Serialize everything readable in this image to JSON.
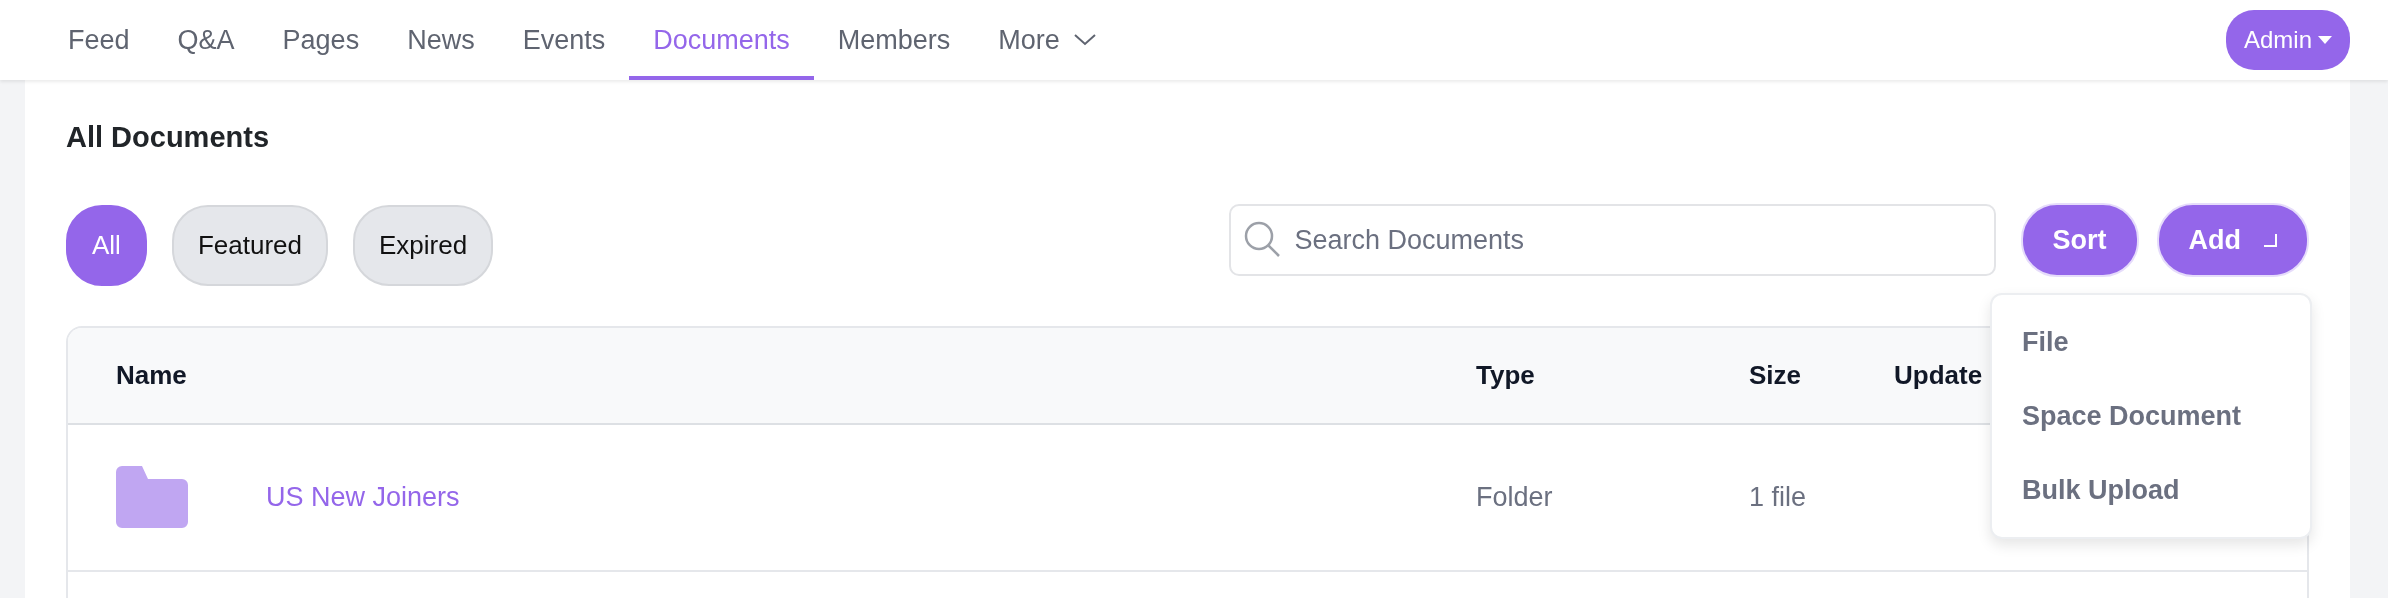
{
  "nav": {
    "tabs": [
      {
        "label": "Feed",
        "selected": false
      },
      {
        "label": "Q&A",
        "selected": false
      },
      {
        "label": "Pages",
        "selected": false
      },
      {
        "label": "News",
        "selected": false
      },
      {
        "label": "Events",
        "selected": false
      },
      {
        "label": "Documents",
        "selected": true
      },
      {
        "label": "Members",
        "selected": false
      },
      {
        "label": "More",
        "selected": false,
        "kind": "menu"
      }
    ],
    "user_button": "Admin"
  },
  "title": "All Documents",
  "filters": [
    {
      "label": "All",
      "selected": true
    },
    {
      "label": "Featured",
      "selected": false
    },
    {
      "label": "Expired",
      "selected": false
    }
  ],
  "search": {
    "placeholder": "Search Documents"
  },
  "sort_button": "Sort",
  "add_button": "Add",
  "add_menu": {
    "items": [
      "File",
      "Space Document",
      "Bulk Upload"
    ]
  },
  "table": {
    "columns": [
      "Name",
      "Type",
      "Size",
      "Update"
    ],
    "rows": [
      {
        "kind": "folder",
        "name": "US New Joiners",
        "type": "Folder",
        "size": "1 file"
      }
    ]
  }
}
